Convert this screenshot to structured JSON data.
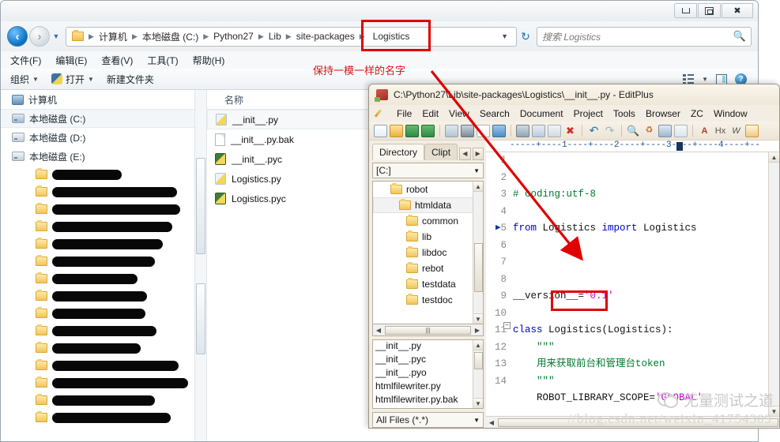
{
  "explorer": {
    "window_controls": {
      "minimize": "–",
      "maximize": "❐",
      "close": "✕"
    },
    "address": {
      "crumbs": [
        "计算机",
        "本地磁盘 (C:)",
        "Python27",
        "Lib",
        "site-packages"
      ],
      "current": "Logistics",
      "dropdown_caret": "▼",
      "refresh_icon": "refresh-icon"
    },
    "search": {
      "placeholder": "搜索 Logistics",
      "icon": "search-icon"
    },
    "menubar": [
      "文件(F)",
      "编辑(E)",
      "查看(V)",
      "工具(T)",
      "帮助(H)"
    ],
    "toolbar": {
      "organize": "组织",
      "open": "打开",
      "new_folder": "新建文件夹",
      "caret": "▼",
      "help": "?"
    },
    "navpane": {
      "computer": "计算机",
      "drives": [
        "本地磁盘 (C:)",
        "本地磁盘 (D:)",
        "本地磁盘 (E:)"
      ],
      "redacted_widths": [
        88,
        158,
        162,
        152,
        140,
        130,
        108,
        120,
        118,
        132,
        112,
        160,
        172,
        130,
        150
      ]
    },
    "list": {
      "header": "名称",
      "files": [
        {
          "name": "__init__.py",
          "icon": "python-file-icon",
          "selected": true
        },
        {
          "name": "__init__.py.bak",
          "icon": "text-file-icon",
          "selected": false
        },
        {
          "name": "__init__.pyc",
          "icon": "python-compiled-icon",
          "selected": false
        },
        {
          "name": "Logistics.py",
          "icon": "python-file-icon",
          "selected": false
        },
        {
          "name": "Logistics.pyc",
          "icon": "python-compiled-icon",
          "selected": false
        }
      ]
    }
  },
  "annotation": {
    "note": "保持一模一样的名字",
    "accent_color": "#e00000"
  },
  "editplus": {
    "title": "C:\\Python27\\Lib\\site-packages\\Logistics\\__init__.py - EditPlus",
    "menubar": [
      "File",
      "Edit",
      "View",
      "Search",
      "Document",
      "Project",
      "Tools",
      "Browser",
      "ZC",
      "Window"
    ],
    "toolbar_text_icons": [
      "A",
      "Hx",
      "W"
    ],
    "panel": {
      "tabs": [
        "Directory",
        "Clipt"
      ],
      "drive": "[C:]",
      "tree": [
        {
          "label": "robot",
          "indent": 22,
          "selected": false
        },
        {
          "label": "htmldata",
          "indent": 32,
          "selected": true
        },
        {
          "label": "common",
          "indent": 42,
          "selected": false
        },
        {
          "label": "lib",
          "indent": 42,
          "selected": false
        },
        {
          "label": "libdoc",
          "indent": 42,
          "selected": false
        },
        {
          "label": "rebot",
          "indent": 42,
          "selected": false
        },
        {
          "label": "testdata",
          "indent": 42,
          "selected": false
        },
        {
          "label": "testdoc",
          "indent": 42,
          "selected": false
        }
      ],
      "files": [
        "__init__.py",
        "__init__.pyc",
        "__init__.pyo",
        "htmlfilewriter.py",
        "htmlfilewriter.py.bak"
      ],
      "filter": "All Files (*.*)"
    },
    "ruler": "-----+----1----+----2----+----3----+----4----+--",
    "code_lines": [
      {
        "n": 1,
        "text": "# coding:utf-8",
        "cls": "cm"
      },
      {
        "n": 2,
        "text": "",
        "cls": "pl"
      },
      {
        "n": 3,
        "text": "from Logistics import Logistics",
        "cls": "mix-import"
      },
      {
        "n": 4,
        "text": "",
        "cls": "pl"
      },
      {
        "n": 5,
        "text": "",
        "cls": "pl"
      },
      {
        "n": 6,
        "text": "",
        "cls": "pl"
      },
      {
        "n": 7,
        "text": "__version__='0.1'",
        "cls": "mix-version"
      },
      {
        "n": 8,
        "text": "",
        "cls": "pl"
      },
      {
        "n": 9,
        "text": "class Logistics(Logistics):",
        "cls": "mix-class"
      },
      {
        "n": 10,
        "text": "    \"\"\"",
        "cls": "doc"
      },
      {
        "n": 11,
        "text": "    用来获取前台和管理台token",
        "cls": "doc"
      },
      {
        "n": 12,
        "text": "    \"\"\"",
        "cls": "doc"
      },
      {
        "n": 13,
        "text": "    ROBOT_LIBRARY_SCOPE='GLOBAL'",
        "cls": "mix-scope"
      },
      {
        "n": 14,
        "text": "",
        "cls": "pl"
      }
    ],
    "code_tokens": {
      "l3_from": "from",
      "l3_mod": " Logistics ",
      "l3_import": "import",
      "l3_name": " Logistics",
      "l7_name": "__version__=",
      "l7_val": "'0.1'",
      "l9_class": "class",
      "l9_name": " Logistics",
      "l9_rest": "(Logistics):",
      "l13_name": "    ROBOT_LIBRARY_SCOPE=",
      "l13_val": "'GLOBAL'"
    }
  },
  "watermark": {
    "brand": "无量测试之道",
    "url": "//blog.csdn.net/weixin_41754309"
  }
}
